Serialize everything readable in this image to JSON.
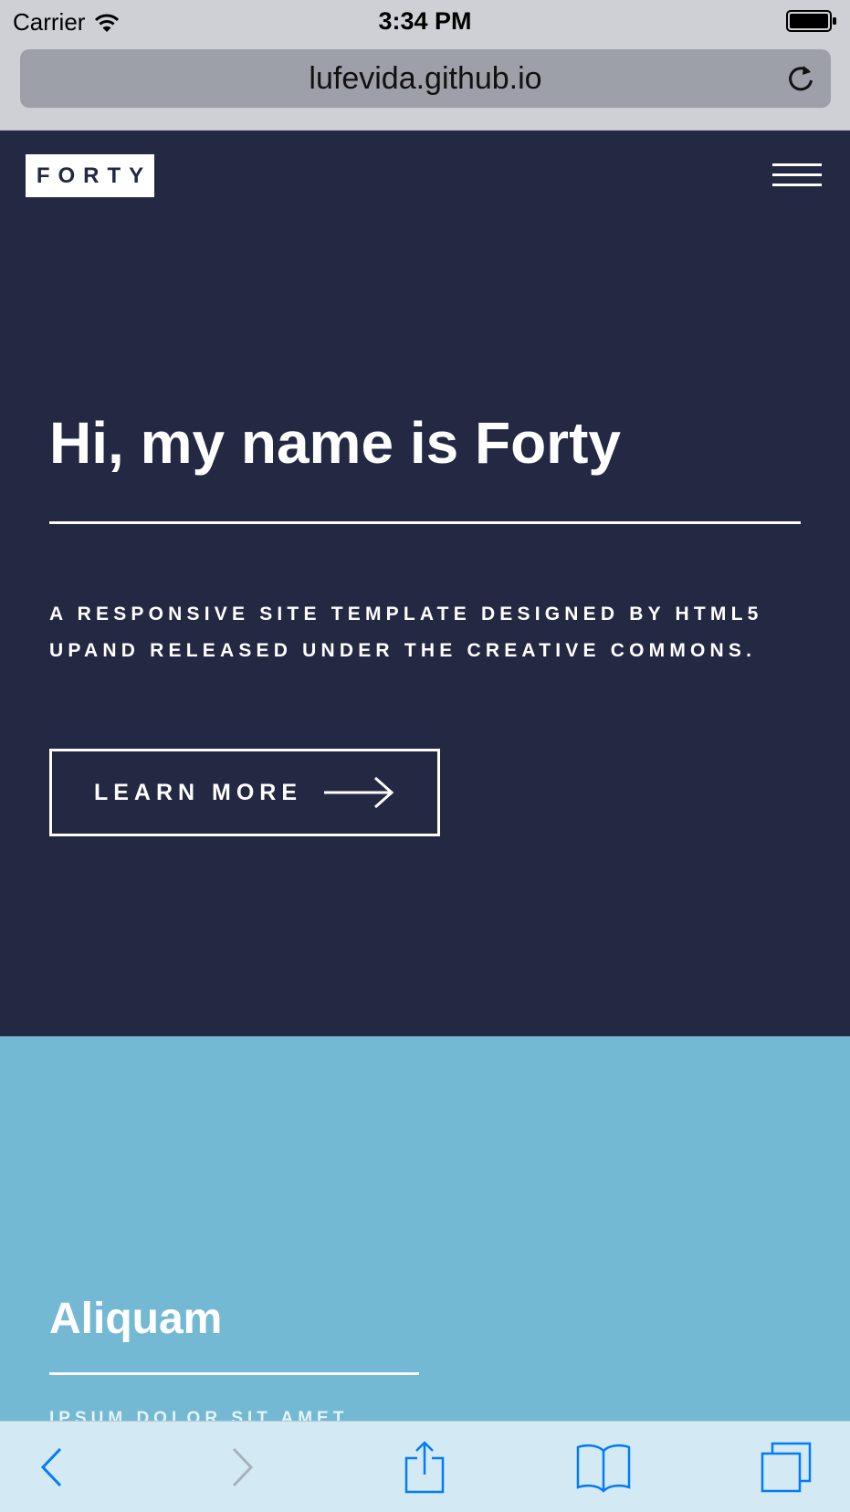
{
  "status_bar": {
    "carrier": "Carrier",
    "time": "3:34 PM",
    "icons": [
      "wifi-icon",
      "battery-icon"
    ]
  },
  "browser": {
    "url": "lufevida.github.io",
    "icons": [
      "reload-icon"
    ],
    "toolbar": [
      "back-icon",
      "forward-icon",
      "share-icon",
      "bookmarks-icon",
      "tabs-icon"
    ],
    "toolbar_color": "#007aff"
  },
  "site": {
    "logo": "FORTY",
    "menu_icon": "menu-icon",
    "hero": {
      "title": "Hi, my name is Forty",
      "description": "A responsive site template designed by HTML5 UPand released under the Creative Commons.",
      "button_label": "LEARN MORE",
      "background": "#242943"
    },
    "tile": {
      "title": "Aliquam",
      "text": "Ipsum dolor sit amet",
      "background": "#74b9d4"
    }
  }
}
